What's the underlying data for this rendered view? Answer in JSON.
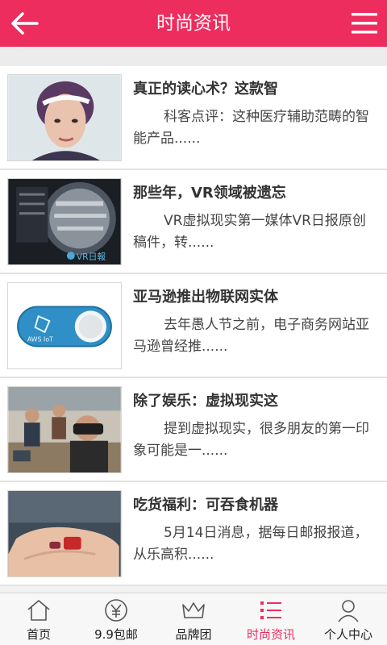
{
  "header": {
    "title": "时尚资讯",
    "back_icon": "arrow-left-icon",
    "menu_icon": "hamburger-menu-icon",
    "accent_color": "#ee2d5f"
  },
  "articles": [
    {
      "title": "真正的读心术？这款智",
      "summary": "科客点评：这种医疗辅助范畴的智能产品......",
      "thumb": "woman-wearing-headband-photo"
    },
    {
      "title": "那些年，VR领域被遗忘",
      "summary": "VR虚拟现实第一媒体VR日报原创稿件，转......",
      "thumb": "vr-circuit-lens-photo",
      "thumb_text": "VR日報"
    },
    {
      "title": "亚马逊推出物联网实体",
      "summary": "去年愚人节之前，电子商务网站亚马逊曾经推......",
      "thumb": "aws-iot-button-photo",
      "thumb_text": "AWS IoT"
    },
    {
      "title": "除了娱乐：虚拟现实这",
      "summary": "提到虚拟现实，很多朋友的第一印象可能是一......",
      "thumb": "people-using-vr-headsets-photo"
    },
    {
      "title": "吃货福利：可吞食机器",
      "summary": "5月14日消息，据每日邮报报道，从乐高积......",
      "thumb": "hand-holding-tiny-robot-photo"
    }
  ],
  "tabbar": {
    "active_color": "#ee2d5f",
    "tabs": [
      {
        "label": "首页",
        "icon": "home-icon"
      },
      {
        "label": "9.9包邮",
        "icon": "yen-coin-icon"
      },
      {
        "label": "品牌团",
        "icon": "crown-icon"
      },
      {
        "label": "时尚资讯",
        "icon": "list-icon",
        "active": true
      },
      {
        "label": "个人中心",
        "icon": "user-icon"
      }
    ]
  }
}
